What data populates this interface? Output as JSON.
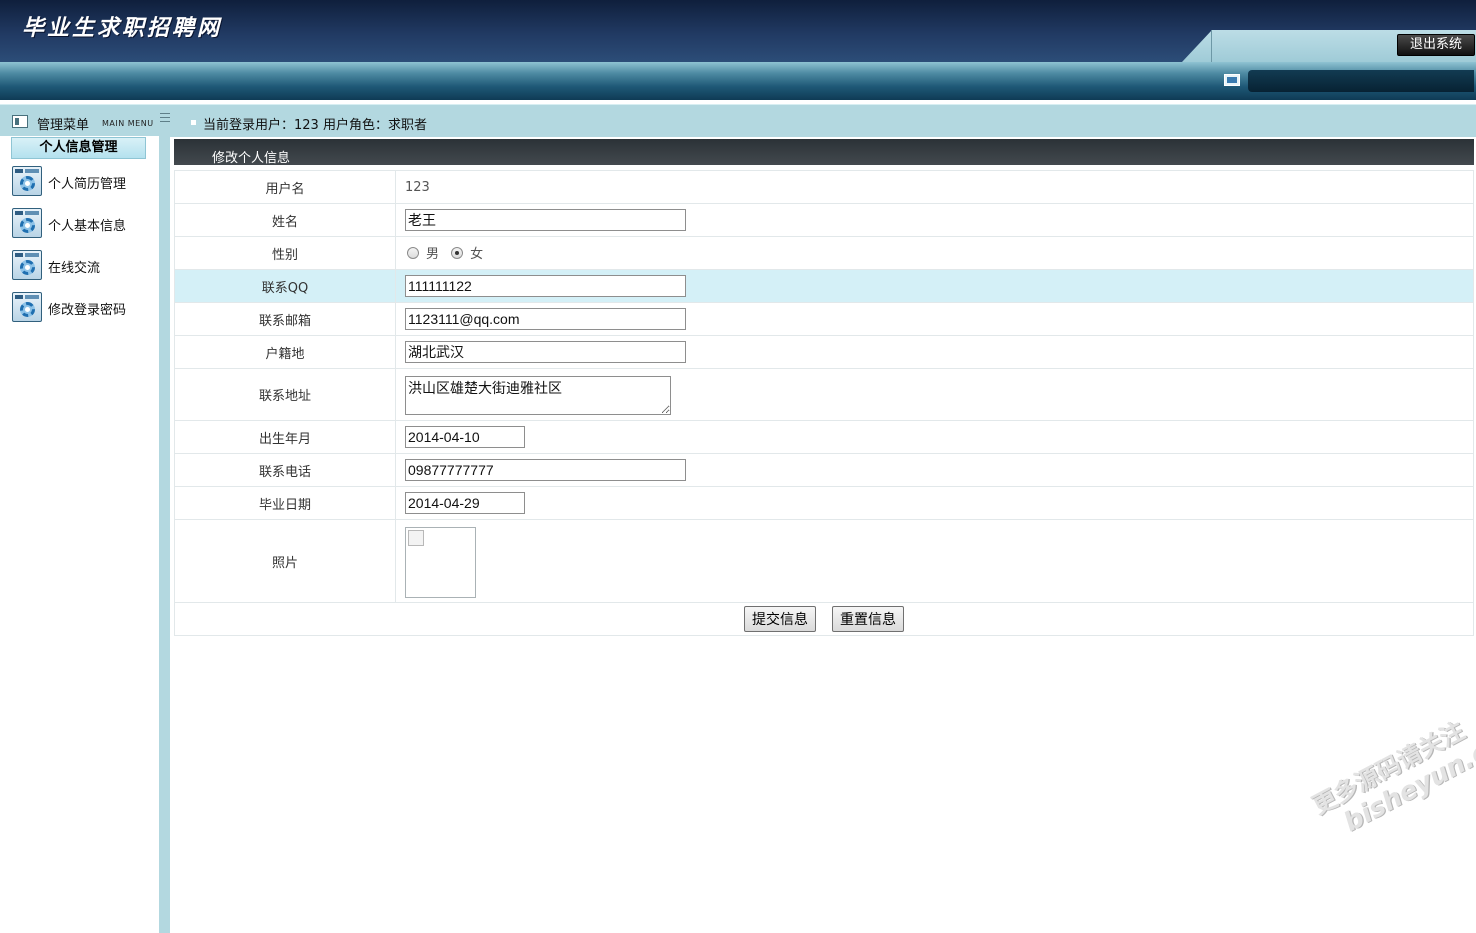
{
  "header": {
    "site_title": "毕业生求职招聘网",
    "logout_label": "退出系统",
    "menu_title": "管理菜单",
    "menu_subtitle": "MAIN MENU",
    "current_user_text": "当前登录用户：123  用户角色：求职者"
  },
  "sidebar": {
    "section_title": "个人信息管理",
    "items": [
      {
        "label": "个人简历管理",
        "icon": "gear-icon"
      },
      {
        "label": "个人基本信息",
        "icon": "gear-icon"
      },
      {
        "label": "在线交流",
        "icon": "gear-icon"
      },
      {
        "label": "修改登录密码",
        "icon": "gear-icon"
      }
    ]
  },
  "main": {
    "panel_title": "修改个人信息",
    "fields": {
      "username": {
        "label": "用户名",
        "value": "123"
      },
      "name": {
        "label": "姓名",
        "value": "老王"
      },
      "gender": {
        "label": "性别",
        "options": [
          "男",
          "女"
        ],
        "selected": "女"
      },
      "qq": {
        "label": "联系QQ",
        "value": "111111122"
      },
      "email": {
        "label": "联系邮箱",
        "value": "1123111@qq.com"
      },
      "hometown": {
        "label": "户籍地",
        "value": "湖北武汉"
      },
      "address": {
        "label": "联系地址",
        "value": "洪山区雄楚大街迪雅社区"
      },
      "birth": {
        "label": "出生年月",
        "value": "2014-04-10"
      },
      "phone": {
        "label": "联系电话",
        "value": "09877777777"
      },
      "graduation": {
        "label": "毕业日期",
        "value": "2014-04-29"
      },
      "photo": {
        "label": "照片"
      }
    },
    "submit_label": "提交信息",
    "reset_label": "重置信息"
  },
  "watermark": {
    "line1": "更多源码请关注",
    "line2": "bisheyun.org"
  },
  "colors": {
    "banner": "#213a63",
    "highlight_row": "#d4f0f7",
    "sidebar_rail": "#b3d8e0",
    "panel_head": "#33393e"
  }
}
